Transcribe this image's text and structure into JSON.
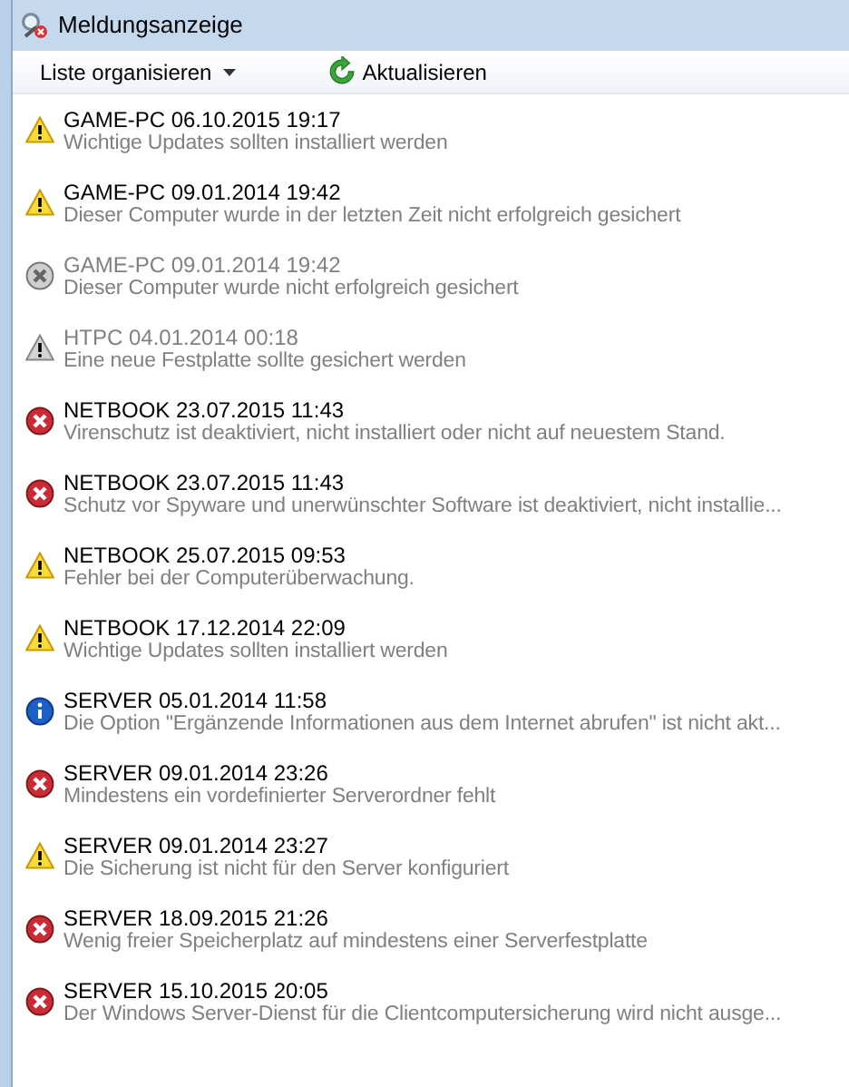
{
  "window": {
    "title": "Meldungsanzeige"
  },
  "toolbar": {
    "organize": "Liste organisieren",
    "refresh": "Aktualisieren"
  },
  "alerts": [
    {
      "kind": "warning",
      "ignored": false,
      "heading": "GAME-PC 06.10.2015 19:17",
      "description": "Wichtige Updates sollten installiert werden"
    },
    {
      "kind": "warning",
      "ignored": false,
      "heading": "GAME-PC 09.01.2014 19:42",
      "description": "Dieser Computer wurde in der letzten Zeit nicht erfolgreich gesichert"
    },
    {
      "kind": "error",
      "ignored": true,
      "heading": "GAME-PC 09.01.2014 19:42",
      "description": "Dieser Computer wurde nicht erfolgreich gesichert"
    },
    {
      "kind": "warning",
      "ignored": true,
      "heading": "HTPC 04.01.2014 00:18",
      "description": "Eine neue Festplatte sollte gesichert werden"
    },
    {
      "kind": "error",
      "ignored": false,
      "heading": "NETBOOK 23.07.2015 11:43",
      "description": "Virenschutz ist deaktiviert, nicht installiert oder nicht auf neuestem Stand."
    },
    {
      "kind": "error",
      "ignored": false,
      "heading": "NETBOOK 23.07.2015 11:43",
      "description": "Schutz vor Spyware und unerwünschter Software ist deaktiviert, nicht installie..."
    },
    {
      "kind": "warning",
      "ignored": false,
      "heading": "NETBOOK 25.07.2015 09:53",
      "description": "Fehler bei der Computerüberwachung."
    },
    {
      "kind": "warning",
      "ignored": false,
      "heading": "NETBOOK 17.12.2014 22:09",
      "description": "Wichtige Updates sollten installiert werden"
    },
    {
      "kind": "info",
      "ignored": false,
      "heading": "SERVER 05.01.2014 11:58",
      "description": "Die Option \"Ergänzende Informationen aus dem Internet abrufen\" ist nicht akt..."
    },
    {
      "kind": "error",
      "ignored": false,
      "heading": "SERVER 09.01.2014 23:26",
      "description": "Mindestens ein vordefinierter Serverordner fehlt"
    },
    {
      "kind": "warning",
      "ignored": false,
      "heading": "SERVER 09.01.2014 23:27",
      "description": "Die Sicherung ist nicht für den Server konfiguriert"
    },
    {
      "kind": "error",
      "ignored": false,
      "heading": "SERVER 18.09.2015 21:26",
      "description": "Wenig freier Speicherplatz auf mindestens einer Serverfestplatte"
    },
    {
      "kind": "error",
      "ignored": false,
      "heading": "SERVER 15.10.2015 20:05",
      "description": "Der Windows Server-Dienst für die Clientcomputersicherung wird nicht ausge..."
    }
  ]
}
